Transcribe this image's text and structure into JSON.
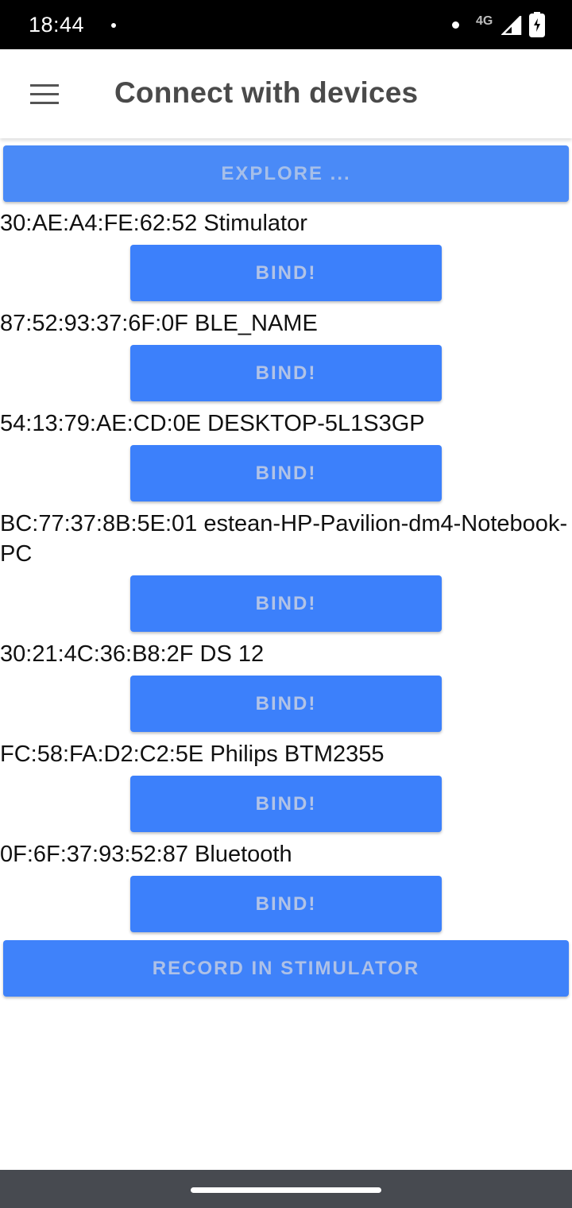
{
  "status_bar": {
    "time": "18:44",
    "network": "4G",
    "icons": [
      "notification-dot-icon",
      "signal-icon",
      "battery-icon"
    ]
  },
  "app_bar": {
    "title": "Connect with devices",
    "menu_icon": "hamburger-menu-icon"
  },
  "explore_button": "EXPLORE ...",
  "devices": [
    {
      "label": "30:AE:A4:FE:62:52 Stimulator",
      "button": "BIND!"
    },
    {
      "label": "87:52:93:37:6F:0F BLE_NAME",
      "button": "BIND!"
    },
    {
      "label": "54:13:79:AE:CD:0E DESKTOP-5L1S3GP",
      "button": "BIND!"
    },
    {
      "label": "BC:77:37:8B:5E:01 estean-HP-Pavilion-dm4-Notebook-PC",
      "button": "BIND!"
    },
    {
      "label": "30:21:4C:36:B8:2F DS 12",
      "button": "BIND!"
    },
    {
      "label": "FC:58:FA:D2:C2:5E Philips BTM2355",
      "button": "BIND!"
    },
    {
      "label": "0F:6F:37:93:52:87 Bluetooth",
      "button": "BIND!"
    }
  ],
  "record_button": "RECORD IN STIMULATOR",
  "colors": {
    "button_primary": "#3c80fb",
    "button_text_disabled": "#b2c3e6",
    "status_bar": "#000000",
    "nav_bar": "#474a50"
  }
}
